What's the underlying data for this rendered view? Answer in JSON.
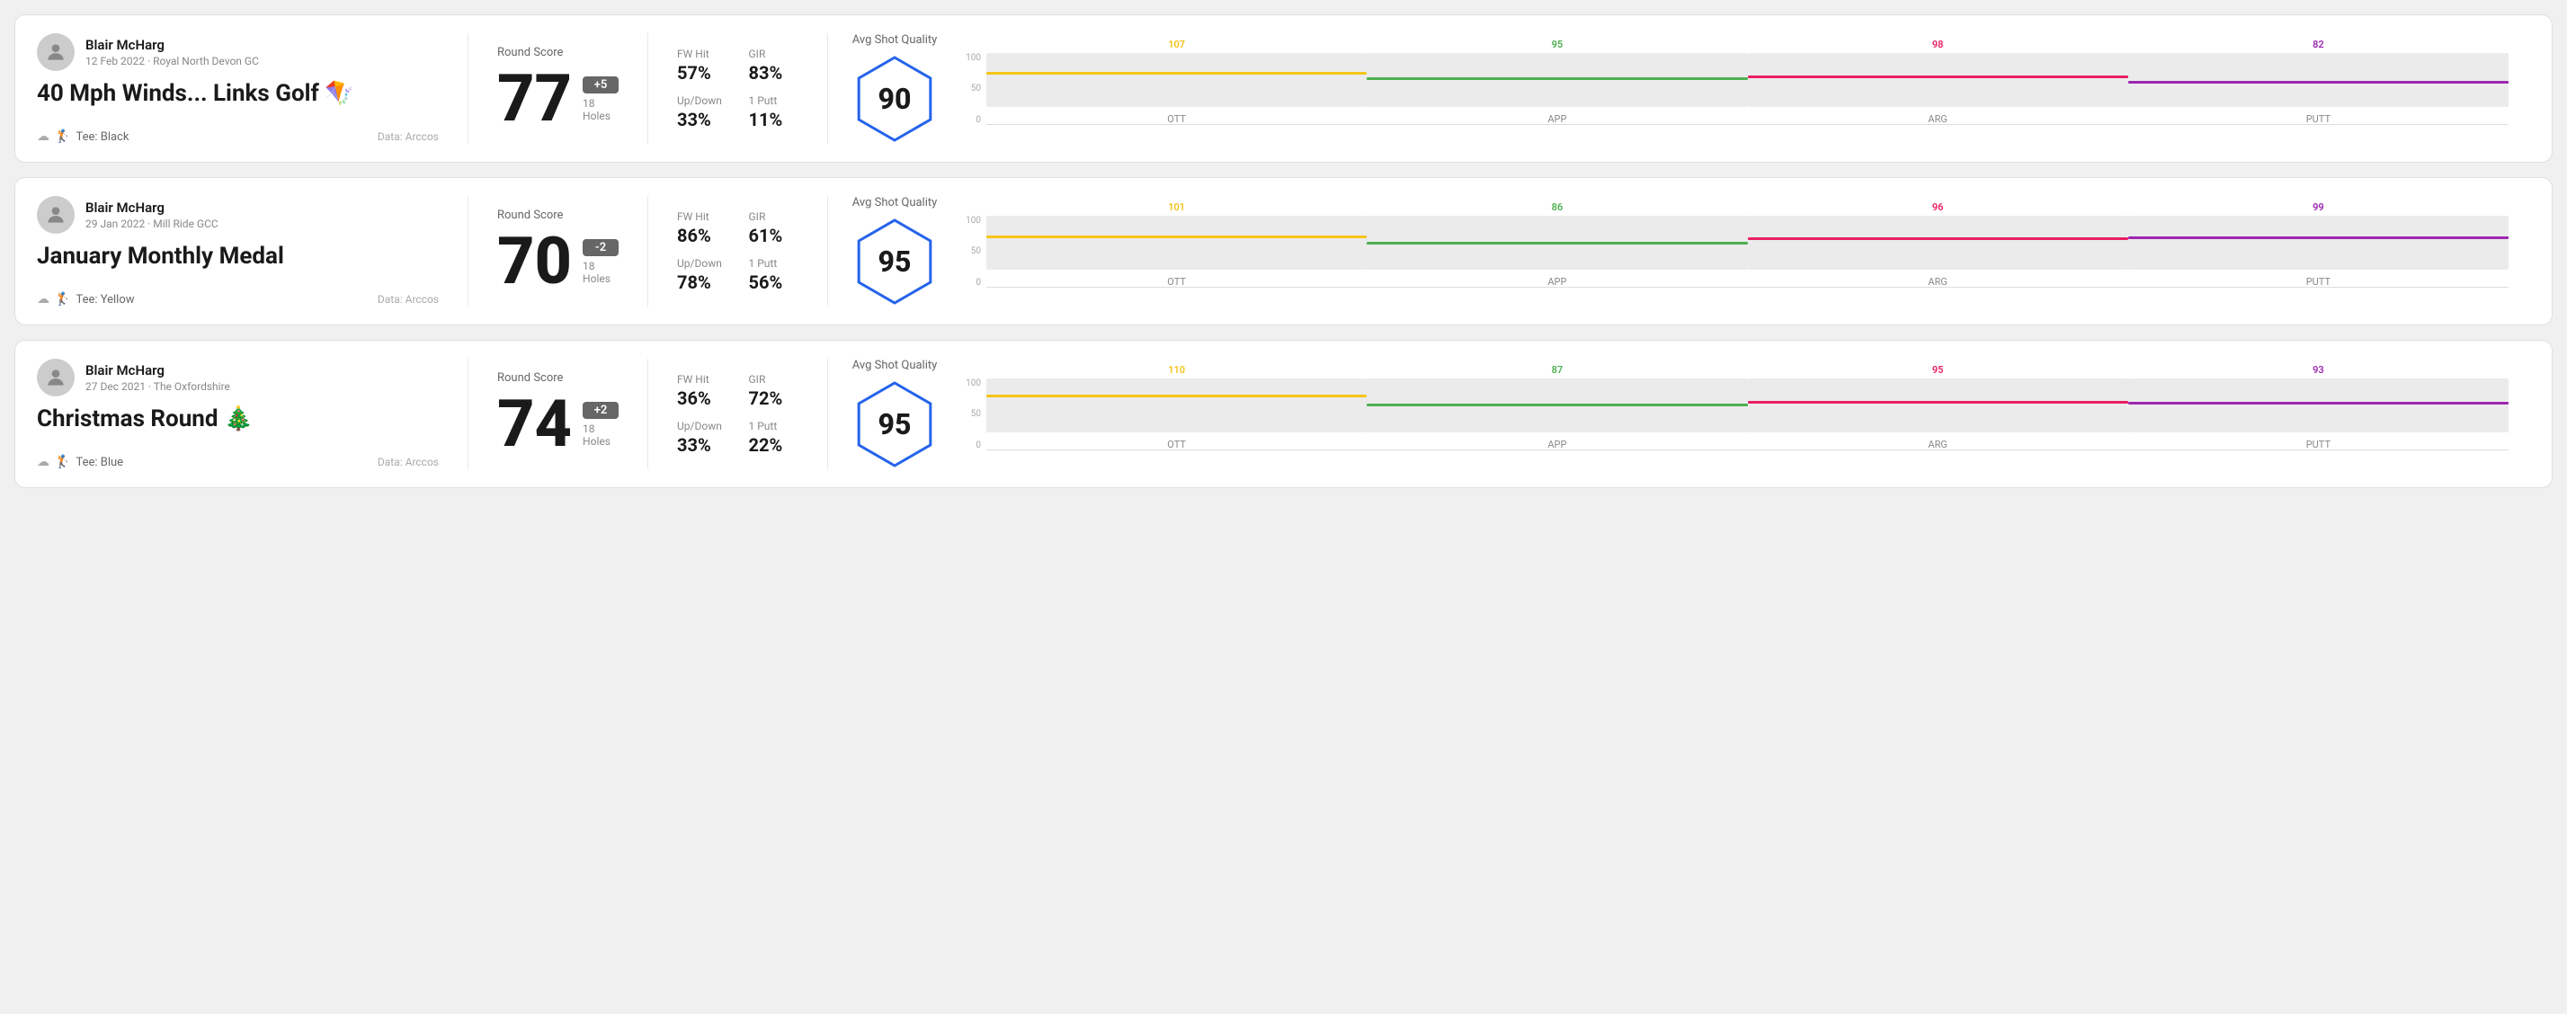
{
  "rounds": [
    {
      "id": "round1",
      "user": {
        "name": "Blair McHarg",
        "meta": "12 Feb 2022 · Royal North Devon GC"
      },
      "title": "40 Mph Winds... Links Golf 🪁",
      "tee": "Black",
      "data_source": "Data: Arccos",
      "score": {
        "value": "77",
        "modifier": "+5",
        "modifier_type": "positive",
        "holes": "18 Holes"
      },
      "stats": {
        "fw_hit_label": "FW Hit",
        "fw_hit_value": "57%",
        "gir_label": "GIR",
        "gir_value": "83%",
        "updown_label": "Up/Down",
        "updown_value": "33%",
        "one_putt_label": "1 Putt",
        "one_putt_value": "11%"
      },
      "quality": {
        "label": "Avg Shot Quality",
        "score": "90",
        "chart": {
          "axis": [
            "100",
            "50",
            "0"
          ],
          "bars": [
            {
              "label": "OTT",
              "value": 107,
              "color": "#f5c518",
              "fill_pct": 60
            },
            {
              "label": "APP",
              "value": 95,
              "color": "#4caf50",
              "fill_pct": 50
            },
            {
              "label": "ARG",
              "value": 98,
              "color": "#e91e63",
              "fill_pct": 52
            },
            {
              "label": "PUTT",
              "value": 82,
              "color": "#9c27b0",
              "fill_pct": 42
            }
          ]
        }
      }
    },
    {
      "id": "round2",
      "user": {
        "name": "Blair McHarg",
        "meta": "29 Jan 2022 · Mill Ride GCC"
      },
      "title": "January Monthly Medal",
      "tee": "Yellow",
      "data_source": "Data: Arccos",
      "score": {
        "value": "70",
        "modifier": "-2",
        "modifier_type": "negative",
        "holes": "18 Holes"
      },
      "stats": {
        "fw_hit_label": "FW Hit",
        "fw_hit_value": "86%",
        "gir_label": "GIR",
        "gir_value": "61%",
        "updown_label": "Up/Down",
        "updown_value": "78%",
        "one_putt_label": "1 Putt",
        "one_putt_value": "56%"
      },
      "quality": {
        "label": "Avg Shot Quality",
        "score": "95",
        "chart": {
          "axis": [
            "100",
            "50",
            "0"
          ],
          "bars": [
            {
              "label": "OTT",
              "value": 101,
              "color": "#f5c518",
              "fill_pct": 58
            },
            {
              "label": "APP",
              "value": 86,
              "color": "#4caf50",
              "fill_pct": 46
            },
            {
              "label": "ARG",
              "value": 96,
              "color": "#e91e63",
              "fill_pct": 54
            },
            {
              "label": "PUTT",
              "value": 99,
              "color": "#9c27b0",
              "fill_pct": 56
            }
          ]
        }
      }
    },
    {
      "id": "round3",
      "user": {
        "name": "Blair McHarg",
        "meta": "27 Dec 2021 · The Oxfordshire"
      },
      "title": "Christmas Round 🎄",
      "tee": "Blue",
      "data_source": "Data: Arccos",
      "score": {
        "value": "74",
        "modifier": "+2",
        "modifier_type": "positive",
        "holes": "18 Holes"
      },
      "stats": {
        "fw_hit_label": "FW Hit",
        "fw_hit_value": "36%",
        "gir_label": "GIR",
        "gir_value": "72%",
        "updown_label": "Up/Down",
        "updown_value": "33%",
        "one_putt_label": "1 Putt",
        "one_putt_value": "22%"
      },
      "quality": {
        "label": "Avg Shot Quality",
        "score": "95",
        "chart": {
          "axis": [
            "100",
            "50",
            "0"
          ],
          "bars": [
            {
              "label": "OTT",
              "value": 110,
              "color": "#f5c518",
              "fill_pct": 64
            },
            {
              "label": "APP",
              "value": 87,
              "color": "#4caf50",
              "fill_pct": 47
            },
            {
              "label": "ARG",
              "value": 95,
              "color": "#e91e63",
              "fill_pct": 53
            },
            {
              "label": "PUTT",
              "value": 93,
              "color": "#9c27b0",
              "fill_pct": 51
            }
          ]
        }
      }
    }
  ],
  "labels": {
    "round_score": "Round Score",
    "avg_shot_quality": "Avg Shot Quality",
    "data_arccos": "Data: Arccos"
  }
}
